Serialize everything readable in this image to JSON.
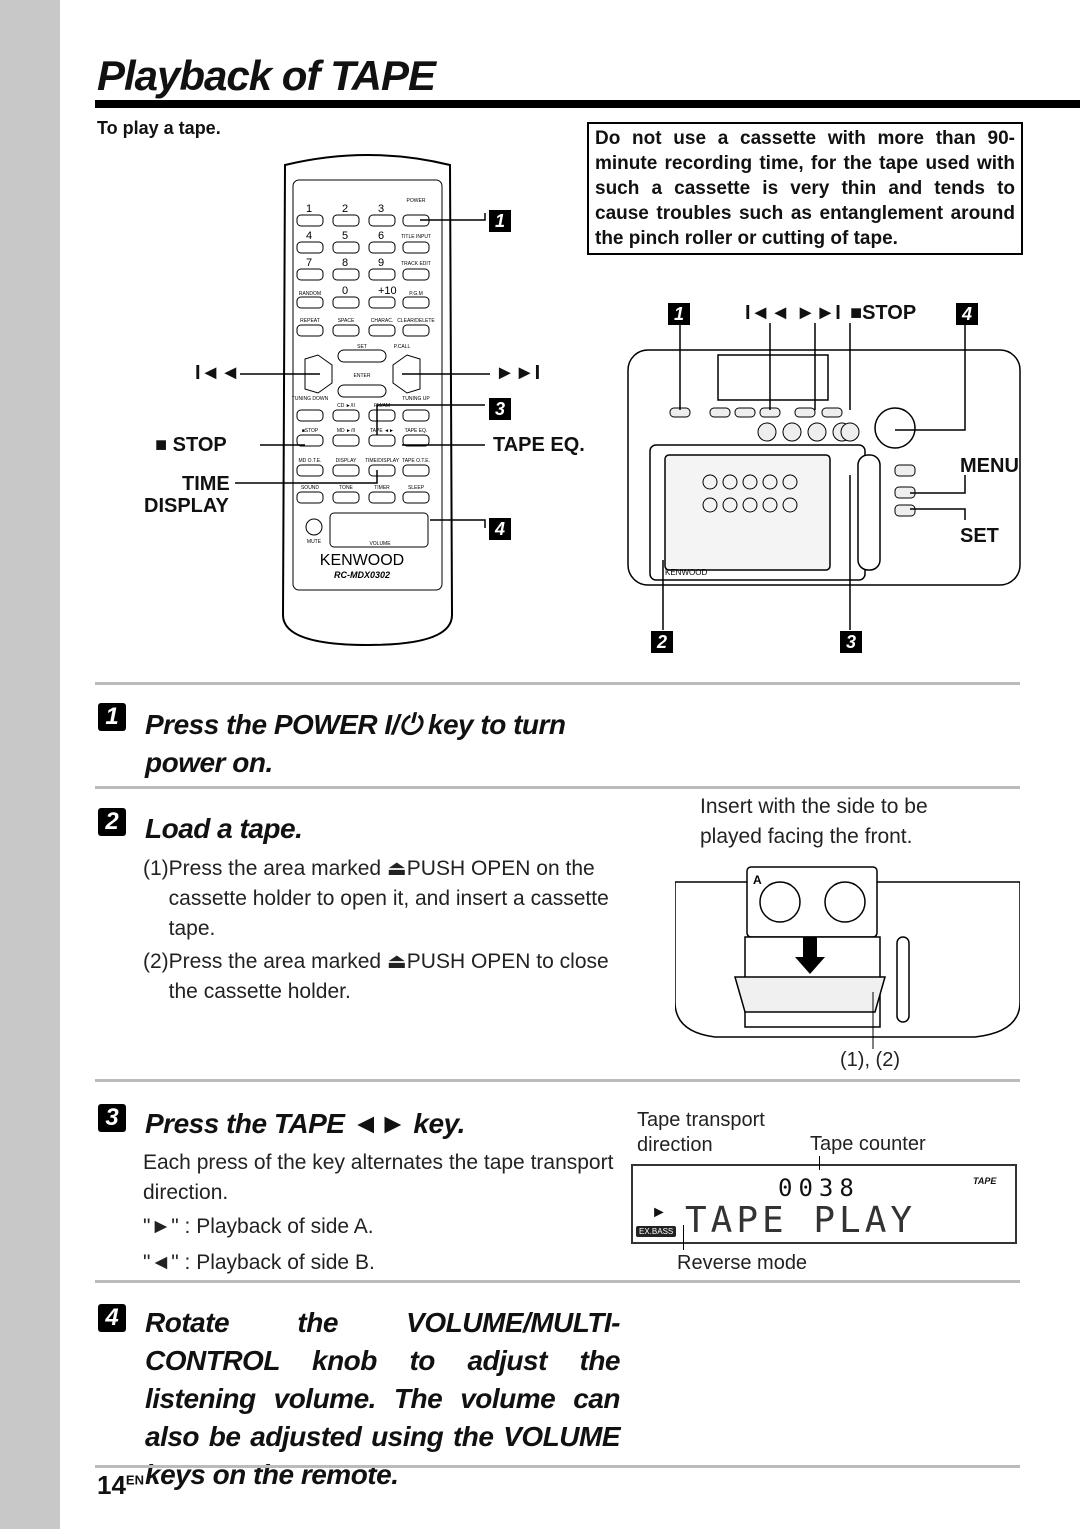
{
  "title": "Playback of TAPE",
  "subtitle": "To play a tape.",
  "warning": "Do not use a cassette with more than 90-minute recording time, for the tape used with such a cassette is very thin and tends to cause troubles such as entanglement around the pinch roller or cutting of tape.",
  "remote": {
    "brand": "KENWOOD",
    "model": "RC-MDX0302",
    "keys": [
      "POWER",
      "TITLE INPUT",
      "TRACK EDIT",
      "RANDOM",
      "P.G.M",
      "REPEAT",
      "SPACE",
      "CHARAC.",
      "CLEAR/DELETE",
      "SET",
      "P.CALL",
      "ENTER",
      "TUNING DOWN",
      "TUNING UP",
      "CD ►/II",
      "FM/AM",
      "■STOP",
      "MD ►/II",
      "TAPE ◄►",
      "TAPE EQ.",
      "MD O.T.E.",
      "DISPLAY",
      "TIME/DISPLAY",
      "TAPE O.T.E.",
      "SOUND",
      "TONE",
      "TIMER",
      "SLEEP",
      "MUTE",
      "VOLUME"
    ],
    "digits": [
      "1",
      "2",
      "3",
      "4",
      "5",
      "6",
      "7",
      "8",
      "9",
      "0",
      "+10"
    ]
  },
  "remote_callouts": {
    "prev": "I◄◄",
    "next": "►►I",
    "stop": "■ STOP",
    "tape_eq": "TAPE EQ.",
    "time": "TIME",
    "display": "DISPLAY",
    "n1": "1",
    "n3": "3",
    "n4": "4"
  },
  "unit_callouts": {
    "n1": "1",
    "skip": "I◄◄ ►►I",
    "stop": "■STOP",
    "n4": "4",
    "menu": "MENU",
    "set": "SET",
    "n2": "2",
    "n3": "3",
    "brand": "KENWOOD"
  },
  "steps": [
    {
      "num": "1",
      "title": "Press the POWER I/⏻ key to turn power on."
    },
    {
      "num": "2",
      "title": "Load a tape.",
      "items": [
        {
          "n": "(1)",
          "text": "Press the area marked ⏏PUSH OPEN on the cassette holder to open it, and insert a cassette tape."
        },
        {
          "n": "(2)",
          "text": "Press the area marked ⏏PUSH OPEN to close the cassette holder."
        }
      ],
      "caption": "Insert with the side to be played facing the front.",
      "fig_label": "(1), (2)"
    },
    {
      "num": "3",
      "title": "Press the TAPE ◄► key.",
      "text": "Each press of the key alternates the tape transport direction.",
      "lines": [
        "\"►\" : Playback of side A.",
        "\"◄\" : Playback of side B."
      ],
      "display": {
        "label_direction": "Tape transport direction",
        "label_counter": "Tape counter",
        "label_reverse": "Reverse mode",
        "counter": "0038",
        "text": "TAPE PLAY",
        "badge": "TAPE",
        "exbass": "EX.BASS"
      }
    },
    {
      "num": "4",
      "title": "Rotate the VOLUME/MULTI-CONTROL knob to adjust the listening volume. The volume can also be adjusted using the VOLUME keys on the remote."
    }
  ],
  "page_number": "14",
  "page_lang": "EN"
}
